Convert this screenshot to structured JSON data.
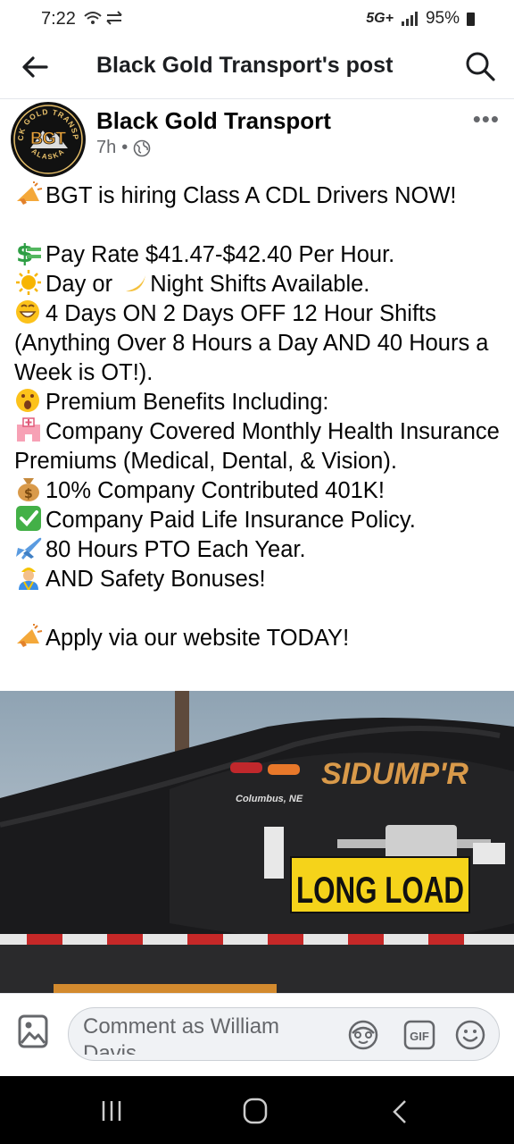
{
  "status_bar": {
    "time": "7:22",
    "network": "5G+",
    "battery": "95%"
  },
  "app_bar": {
    "title": "Black Gold Transport's post"
  },
  "post": {
    "author": "Black Gold Transport",
    "time": "7h",
    "lines": [
      "BGT is hiring Class A CDL Drivers NOW!",
      "Pay Rate $41.47-$42.40 Per Hour.",
      "Day or ",
      "Night Shifts Available.",
      "4 Days ON 2 Days OFF 12 Hour Shifts (Anything Over 8 Hours a Day AND 40 Hours a Week is OT!).",
      "Premium Benefits Including:",
      "Company Covered Monthly Health Insurance Premiums (Medical, Dental, & Vision).",
      "10% Company Contributed 401K!",
      "Company Paid Life Insurance Policy.",
      "80 Hours PTO Each Year.",
      "AND Safety Bonuses!",
      "Apply via our website TODAY!"
    ]
  },
  "image": {
    "brand": "SIDUMP'R",
    "city": "Columbus, NE",
    "sign": "LONG LOAD",
    "logo": "BGT",
    "logo_ring_top": "BLACK GOLD TRANSPORT",
    "logo_ring_bottom": "ALASKA"
  },
  "composer": {
    "placeholder": "Comment as William Davis",
    "gif_label": "GIF"
  },
  "colors": {
    "accent": "#1877f2",
    "muted": "#65676b"
  }
}
